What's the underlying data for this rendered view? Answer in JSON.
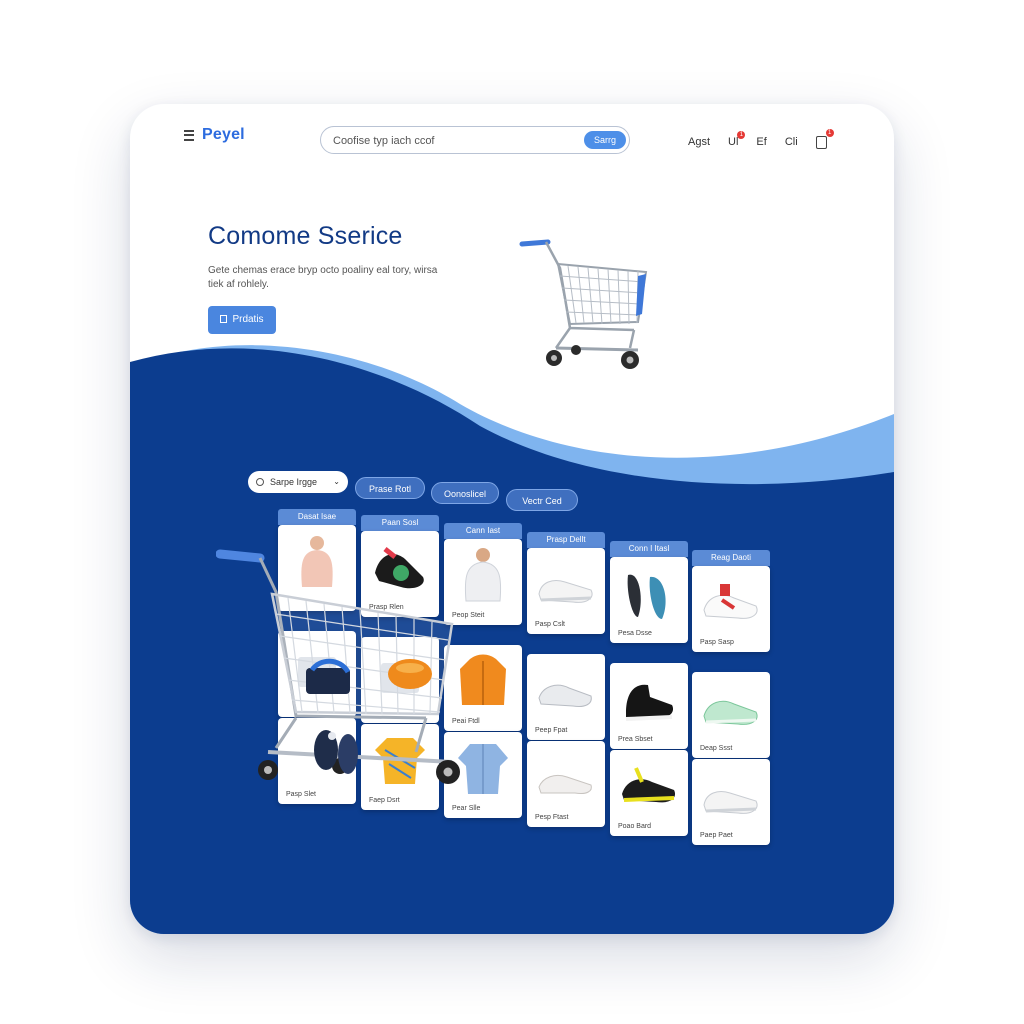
{
  "header": {
    "logo": "Peyel",
    "search": {
      "placeholder": "Coofise typ iach ccof",
      "button": "Sarrg"
    },
    "nav": [
      {
        "label": "Agst"
      },
      {
        "label": "Ul",
        "badge": "1"
      },
      {
        "label": "Ef"
      },
      {
        "label": "Cli"
      },
      {
        "label": "",
        "badge": "1"
      }
    ]
  },
  "hero": {
    "title": "Comome Sserice",
    "subtitle": "Gete chemas erace bryp octo poaliny eal tory, wirsa tiek af rohlely.",
    "button": "Prdatis"
  },
  "filters": [
    {
      "label": "Sarpe Irgge"
    },
    {
      "label": "Prase Rotl"
    },
    {
      "label": "Oonoslicel"
    },
    {
      "label": "Vectr Ced"
    }
  ],
  "columns": [
    "Dasat Isae",
    "Paan Sosl",
    "Cann Iast",
    "Prasp Dellt",
    "Conn I Itasl",
    "Reag Daoti"
  ],
  "products": [
    {
      "col": 0,
      "row": 0,
      "icon": "person-sweater-icon",
      "caption": ""
    },
    {
      "col": 1,
      "row": 0,
      "icon": "sneaker-dark-icon",
      "caption": "Prasp Rlen"
    },
    {
      "col": 2,
      "row": 0,
      "icon": "person-hoodie-icon",
      "caption": "Peop Steit"
    },
    {
      "col": 3,
      "row": 0,
      "icon": "sneaker-white-icon",
      "caption": "Pasp Cslt"
    },
    {
      "col": 4,
      "row": 0,
      "icon": "sandal-pair-icon",
      "caption": "Pesa Dsse"
    },
    {
      "col": 5,
      "row": 0,
      "icon": "sneaker-red-icon",
      "caption": "Pasp Sasp"
    },
    {
      "col": 0,
      "row": 1,
      "icon": "bag-icon",
      "caption": ""
    },
    {
      "col": 1,
      "row": 1,
      "icon": "bag-icon",
      "caption": ""
    },
    {
      "col": 2,
      "row": 1,
      "icon": "jacket-orange-icon",
      "caption": "Peai Ftdl"
    },
    {
      "col": 3,
      "row": 1,
      "icon": "sneaker-grey-icon",
      "caption": "Peep Fpat"
    },
    {
      "col": 4,
      "row": 1,
      "icon": "hightop-black-icon",
      "caption": "Prea Sbset"
    },
    {
      "col": 5,
      "row": 1,
      "icon": "sneaker-green-icon",
      "caption": "Deap Ssst"
    },
    {
      "col": 0,
      "row": 2,
      "icon": "blank-icon",
      "caption": "Pasp Slet"
    },
    {
      "col": 1,
      "row": 2,
      "icon": "shirt-yellow-icon",
      "caption": "Faep Dsrt"
    },
    {
      "col": 2,
      "row": 2,
      "icon": "shirt-blue-icon",
      "caption": "Pear Slle"
    },
    {
      "col": 3,
      "row": 2,
      "icon": "sneaker-white-low-icon",
      "caption": "Pesp Ftast"
    },
    {
      "col": 4,
      "row": 2,
      "icon": "sneaker-yellow-icon",
      "caption": "Poao Bard"
    },
    {
      "col": 5,
      "row": 2,
      "icon": "sneaker-white-icon",
      "caption": "Paep Paet"
    }
  ]
}
